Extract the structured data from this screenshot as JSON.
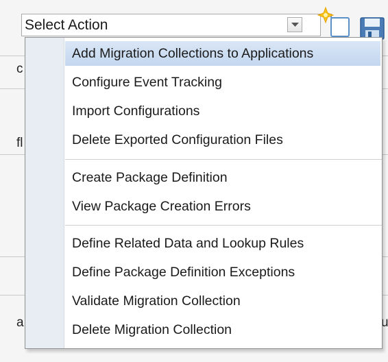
{
  "select": {
    "value": "Select Action"
  },
  "background_fragments": {
    "a": "c",
    "b": "fl",
    "c": "a",
    "d": "u"
  },
  "menu": {
    "groups": [
      [
        "Add Migration Collections to Applications",
        "Configure Event Tracking",
        "Import Configurations",
        "Delete Exported Configuration Files"
      ],
      [
        "Create Package Definition",
        "View Package Creation Errors"
      ],
      [
        "Define Related Data and Lookup Rules",
        "Define Package Definition Exceptions",
        "Validate Migration Collection",
        "Delete Migration Collection"
      ]
    ],
    "highlighted": "Add Migration Collections to Applications"
  },
  "icons": {
    "new": "new-sparkle-icon",
    "save": "save-floppy-icon",
    "dropdown": "chevron-down-icon"
  }
}
